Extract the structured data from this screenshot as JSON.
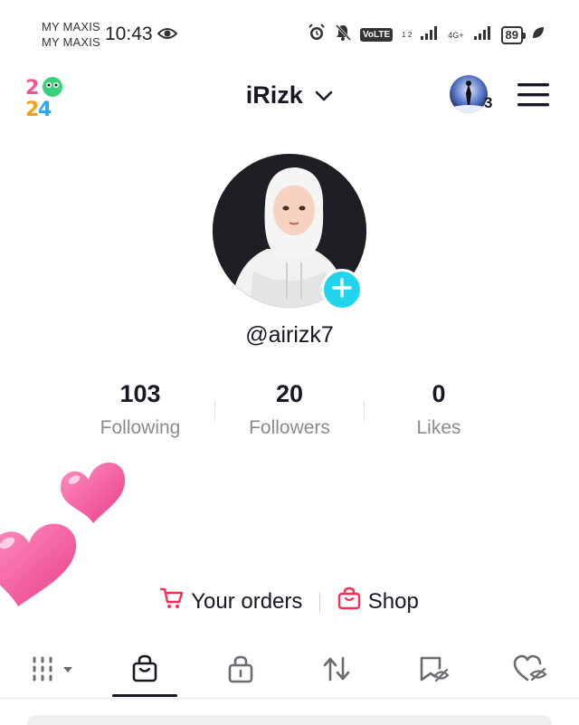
{
  "status_bar": {
    "carrier_1": "MY MAXIS",
    "carrier_2": "MY MAXIS",
    "time": "10:43",
    "volte": "VoLTE",
    "sim_label": "1 2",
    "network": "4G+",
    "battery": "89"
  },
  "header": {
    "badge_icon": "2024-badge-icon",
    "username": "iRizk",
    "account_count": "3"
  },
  "profile": {
    "handle": "@airizk7",
    "stats": [
      {
        "value": "103",
        "label": "Following"
      },
      {
        "value": "20",
        "label": "Followers"
      },
      {
        "value": "0",
        "label": "Likes"
      }
    ]
  },
  "shortcuts": {
    "orders_label": "Your orders",
    "shop_label": "Shop"
  },
  "tabs": [
    {
      "name": "videos",
      "icon": "grid-icon",
      "active": false
    },
    {
      "name": "shop",
      "icon": "shopping-bag-icon",
      "active": true
    },
    {
      "name": "private",
      "icon": "lock-icon",
      "active": false
    },
    {
      "name": "reposts",
      "icon": "repost-icon",
      "active": false
    },
    {
      "name": "favorites",
      "icon": "bookmark-hidden-icon",
      "active": false
    },
    {
      "name": "liked",
      "icon": "heart-hidden-icon",
      "active": false
    }
  ],
  "colors": {
    "accent_cyan": "#20d5ec",
    "brand_red": "#fe2c55",
    "heart_pink": "#f2559a",
    "text_primary": "#161823",
    "text_secondary": "#8a8b91"
  }
}
